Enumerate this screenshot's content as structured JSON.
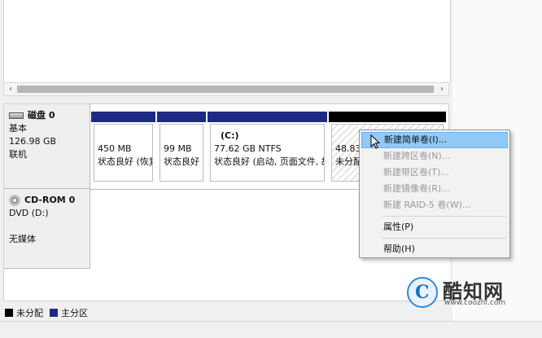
{
  "disks": [
    {
      "name": "磁盘 0",
      "type": "基本",
      "size": "126.98 GB",
      "status": "联机",
      "icon": "hard-disk-icon",
      "partitions": [
        {
          "size": "450 MB",
          "status": "状态良好 (恢复",
          "kind": "primary"
        },
        {
          "size": "99 MB",
          "status": "状态良好 (EFI",
          "kind": "primary"
        },
        {
          "label": "(C:)",
          "size": "77.62 GB NTFS",
          "status": "状态良好 (启动, 页面文件, 故",
          "kind": "primary"
        },
        {
          "size": "48.83",
          "status": "未分配",
          "kind": "unallocated"
        }
      ]
    },
    {
      "name": "CD-ROM 0",
      "type": "DVD (D:)",
      "status": "无媒体",
      "icon": "cdrom-icon"
    }
  ],
  "legend": [
    {
      "label": "未分配",
      "color": "#000000"
    },
    {
      "label": "主分区",
      "color": "#1c2a86"
    }
  ],
  "context_menu": {
    "items": [
      {
        "label": "新建简单卷(I)...",
        "enabled": true,
        "highlighted": true
      },
      {
        "label": "新建跨区卷(N)...",
        "enabled": false
      },
      {
        "label": "新建带区卷(T)...",
        "enabled": false
      },
      {
        "label": "新建镜像卷(R)...",
        "enabled": false
      },
      {
        "label": "新建 RAID-5 卷(W)...",
        "enabled": false
      },
      {
        "label": "属性(P)",
        "enabled": true
      },
      {
        "label": "帮助(H)",
        "enabled": true
      }
    ]
  },
  "watermark": {
    "title": "酷知网",
    "url": "www.coozhi.com",
    "logo_letter": "C"
  },
  "colors": {
    "primary_partition": "#1c2a86",
    "unallocated": "#000000",
    "menu_highlight": "#91c9f7"
  }
}
